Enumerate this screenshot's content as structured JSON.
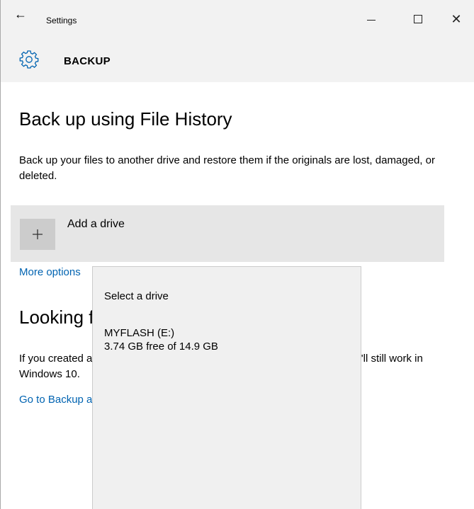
{
  "window": {
    "title": "Settings",
    "back_icon": "arrow-left-icon",
    "minimize_icon": "minimize-icon",
    "maximize_icon": "maximize-icon",
    "close_icon": "close-icon"
  },
  "header": {
    "icon": "gear-icon",
    "title": "BACKUP"
  },
  "file_history": {
    "title": "Back up using File History",
    "description": "Back up your files to another drive and restore them if the originals are lost, damaged, or deleted.",
    "add_drive_label": "Add a drive",
    "more_options": "More options"
  },
  "older_backup": {
    "title": "Looking for an older backup?",
    "description": "If you created a backup using the Windows 7 Backup and Restore tool, it'll still work in Windows 10.",
    "link": "Go to Backup and Restore (Windows 7)"
  },
  "flyout": {
    "title": "Select a drive",
    "drives": [
      {
        "name": "MYFLASH (E:)",
        "free": "3.74 GB free of 14.9 GB"
      }
    ]
  },
  "colors": {
    "accent": "#0063b1",
    "titlebar_bg": "#f2f2f2",
    "row_bg": "#e6e6e6",
    "flyout_bg": "#f0f0f0"
  }
}
